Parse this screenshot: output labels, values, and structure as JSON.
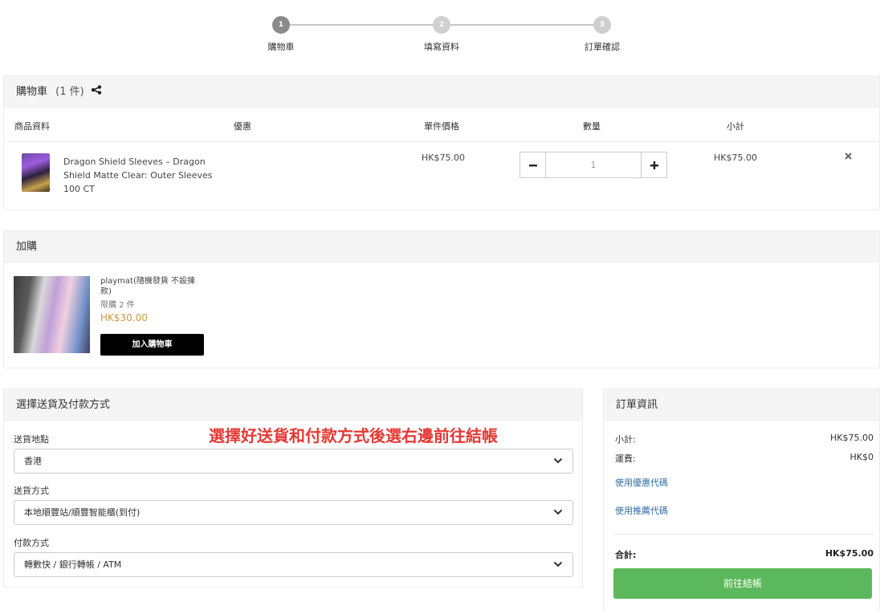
{
  "steps": [
    {
      "num": "1",
      "label": "購物車"
    },
    {
      "num": "2",
      "label": "填寫資料"
    },
    {
      "num": "3",
      "label": "訂單確認"
    }
  ],
  "cart": {
    "title": "購物車",
    "count": "(1 件)",
    "headers": {
      "product": "商品資料",
      "discount": "優惠",
      "unit_price": "單件價格",
      "quantity": "數量",
      "subtotal": "小計"
    },
    "items": [
      {
        "name": "Dragon Shield Sleeves – Dragon Shield Matte Clear: Outer Sleeves 100 CT",
        "unit_price": "HK$75.00",
        "quantity": "1",
        "subtotal": "HK$75.00"
      }
    ]
  },
  "addon": {
    "title": "加購",
    "item": {
      "name": "playmat(隨機發貨 不設揀款)",
      "limit": "限購 2 件",
      "price": "HK$30.00",
      "button": "加入購物車"
    }
  },
  "delivery": {
    "title": "選擇送貨及付款方式",
    "notice": "選擇好送貨和付款方式後選右邊前往結帳",
    "fields": [
      {
        "label": "送貨地點",
        "value": "香港"
      },
      {
        "label": "送貨方式",
        "value": "本地順豐站/順豐智能櫃(到付)"
      },
      {
        "label": "付款方式",
        "value": "轉數快 / 銀行轉帳 / ATM"
      }
    ]
  },
  "summary": {
    "title": "訂單資訊",
    "subtotal_label": "小計:",
    "subtotal_value": "HK$75.00",
    "shipping_label": "運費:",
    "shipping_value": "HK$0",
    "coupon_link": "使用優惠代碼",
    "referral_link": "使用推薦代碼",
    "total_label": "合計:",
    "total_value": "HK$75.00",
    "checkout_button": "前往結帳"
  },
  "colors": {
    "accent_green": "#5cb85c",
    "notice_red": "#e53935",
    "price_gold": "#c79a45",
    "link_blue": "#2e6da4"
  }
}
